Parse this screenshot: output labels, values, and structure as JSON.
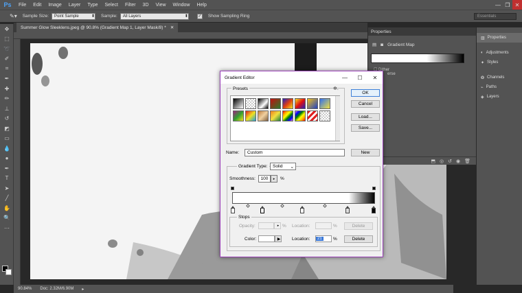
{
  "app": {
    "logo": "Ps"
  },
  "menu": [
    "File",
    "Edit",
    "Image",
    "Layer",
    "Type",
    "Select",
    "Filter",
    "3D",
    "View",
    "Window",
    "Help"
  ],
  "window_controls": {
    "minimize": "—",
    "restore": "❐",
    "close": "✕"
  },
  "options_bar": {
    "sample_size_label": "Sample Size:",
    "sample_size_value": "Point Sample",
    "sample_label": "Sample:",
    "sample_value": "All Layers",
    "sampling_ring_label": "Show Sampling Ring",
    "workspace": "Essentials"
  },
  "document": {
    "tab_title": "Summer Glow Sleeklens.jpeg @ 90.8% (Gradient Map 1, Layer Mask/8) *",
    "zoom": "90.84%",
    "doc_info": "Doc: 2.32M/6.90M"
  },
  "properties_panel": {
    "tab": "Properties",
    "title": "Gradient Map",
    "dither_label": "Dither",
    "reverse_label": "erse"
  },
  "dock": {
    "items": [
      {
        "label": "Properties",
        "icon": "properties-icon"
      },
      {
        "label": "Adjustments",
        "icon": "adjustments-icon"
      },
      {
        "label": "Styles",
        "icon": "styles-icon"
      },
      {
        "label": "Channels",
        "icon": "channels-icon"
      },
      {
        "label": "Paths",
        "icon": "paths-icon"
      },
      {
        "label": "Layers",
        "icon": "layers-icon"
      }
    ]
  },
  "dialog": {
    "title": "Gradient Editor",
    "presets_label": "Presets",
    "buttons": {
      "ok": "OK",
      "cancel": "Cancel",
      "load": "Load...",
      "save": "Save...",
      "new": "New"
    },
    "name_label": "Name:",
    "name_value": "Custom",
    "gradient_type_label": "Gradient Type:",
    "gradient_type_value": "Solid",
    "smoothness_label": "Smoothness:",
    "smoothness_value": "100",
    "percent": "%",
    "stops_label": "Stops",
    "opacity_label": "Opacity:",
    "location_label": "Location:",
    "color_label": "Color:",
    "delete_label": "Delete",
    "color_location_value": "21"
  }
}
